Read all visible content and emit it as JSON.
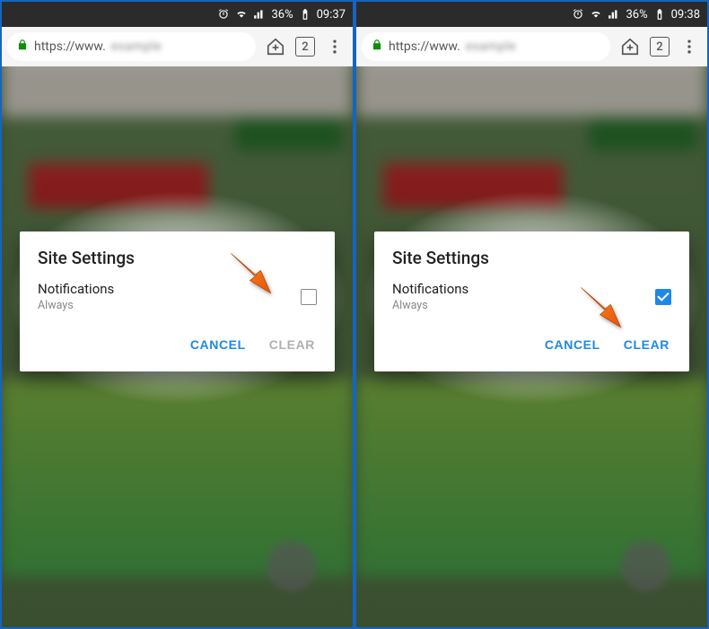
{
  "status": {
    "battery": "36%",
    "time_left": "09:37",
    "time_right": "09:38"
  },
  "urlbar": {
    "scheme": "https://www.",
    "hidden_domain": "example",
    "tab_count": "2"
  },
  "dialog": {
    "title": "Site Settings",
    "row_label": "Notifications",
    "row_sub": "Always",
    "cancel": "CANCEL",
    "clear": "CLEAR"
  }
}
